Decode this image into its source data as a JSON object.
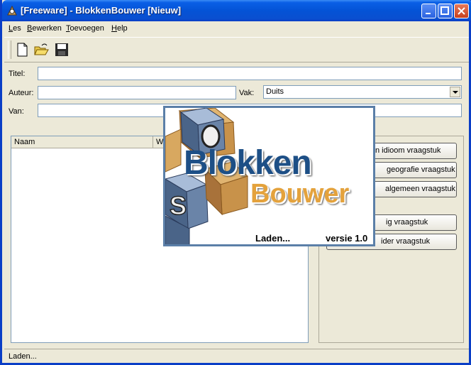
{
  "window": {
    "title": "[Freeware] - BlokkenBouwer [Nieuw]"
  },
  "menu": {
    "items": [
      "Les",
      "Bewerken",
      "Toevoegen",
      "Help"
    ]
  },
  "toolbar": {
    "icons": [
      "new-document-icon",
      "open-folder-icon",
      "save-disk-icon"
    ]
  },
  "form": {
    "titel_label": "Titel:",
    "titel_value": "",
    "auteur_label": "Auteur:",
    "auteur_value": "",
    "vak_label": "Vak:",
    "vak_value": "Duits",
    "van_label": "Van:",
    "van_value": ""
  },
  "list": {
    "columns": [
      "Naam",
      "W"
    ]
  },
  "buttons": {
    "idioom": "n idioom vraagstuk",
    "geografie": "geografie vraagstuk",
    "algemeen": "algemeen vraagstuk",
    "b4": "ig vraagstuk",
    "b5": "ider vraagstuk"
  },
  "status": {
    "text": "Laden..."
  },
  "splash": {
    "title_part1": "Blokken",
    "title_part2": "Bouwer",
    "loading": "Laden...",
    "version": "versie 1.0"
  },
  "colors": {
    "titlebar": "#0453d6",
    "splash_blue": "#1d4f86",
    "splash_orange": "#e4a23c"
  }
}
